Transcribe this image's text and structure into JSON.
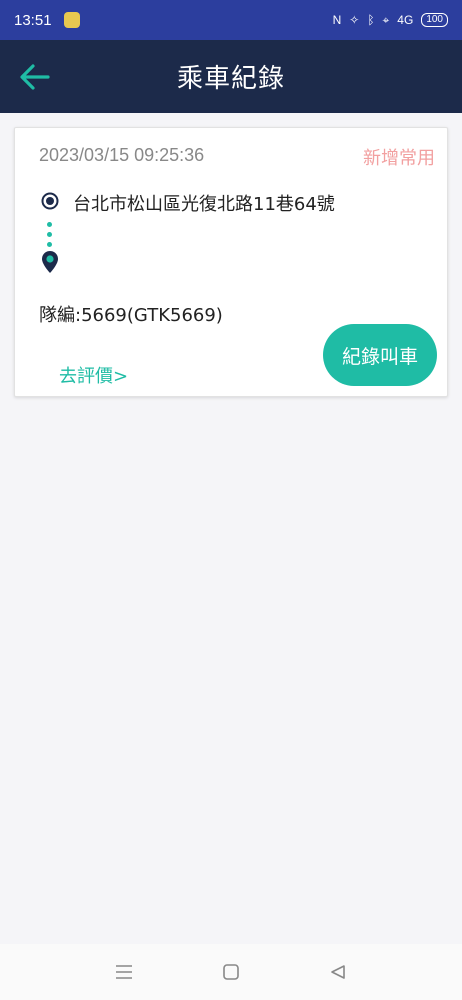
{
  "status_bar": {
    "time": "13:51",
    "signal_label": "4G",
    "battery": "100"
  },
  "header": {
    "title": "乘車紀錄"
  },
  "record": {
    "datetime": "2023/03/15 09:25:36",
    "add_favorite": "新增常用",
    "origin": "台北市松山區光復北路11巷64號",
    "fleet_number": "隊編:5669(GTK5669)",
    "rate_link": "去評價>",
    "recall_button": "紀錄叫車"
  },
  "colors": {
    "status_bar": "#2c3e9e",
    "app_bar": "#1c2a4a",
    "accent": "#1fbca5",
    "favorite": "#f2a0a0"
  }
}
